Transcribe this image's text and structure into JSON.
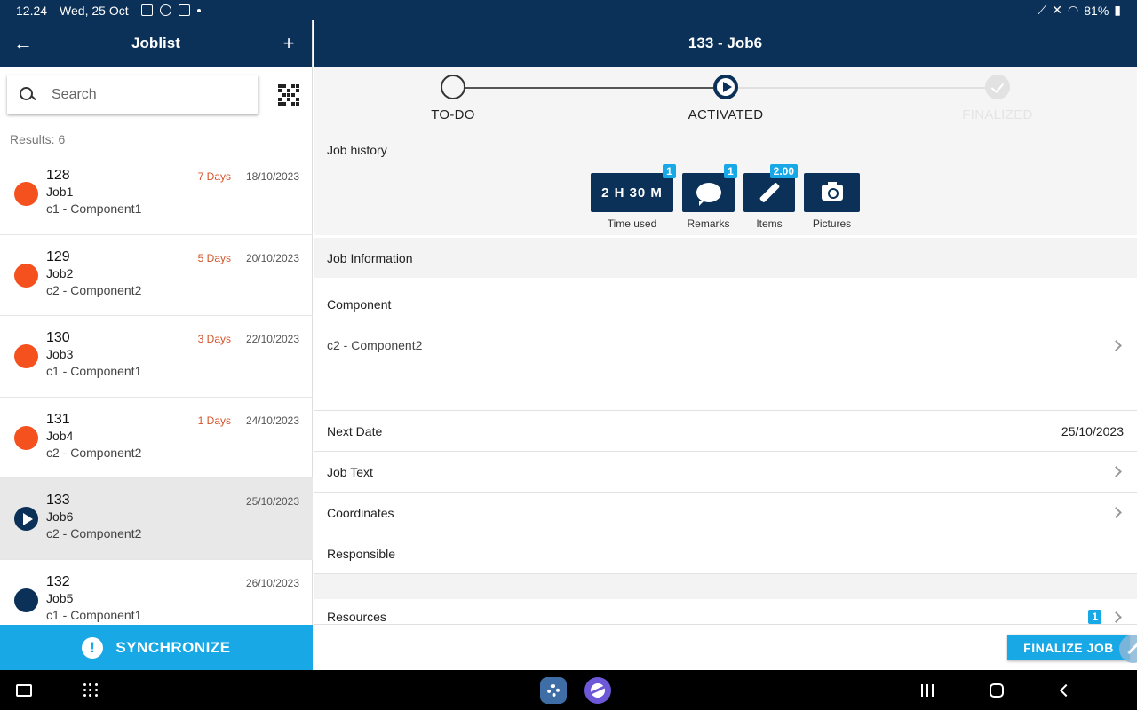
{
  "status_bar": {
    "time": "12.24",
    "date": "Wed, 25 Oct",
    "battery": "81%"
  },
  "joblist": {
    "title": "Joblist",
    "search_placeholder": "Search",
    "results": "Results: 6",
    "jobs": [
      {
        "number": "128",
        "name": "Job1",
        "component": "c1 - Component1",
        "days": "7 Days",
        "date": "18/10/2023",
        "state": "overdue"
      },
      {
        "number": "129",
        "name": "Job2",
        "component": "c2 - Component2",
        "days": "5 Days",
        "date": "20/10/2023",
        "state": "overdue"
      },
      {
        "number": "130",
        "name": "Job3",
        "component": "c1 - Component1",
        "days": "3 Days",
        "date": "22/10/2023",
        "state": "overdue"
      },
      {
        "number": "131",
        "name": "Job4",
        "component": "c2 - Component2",
        "days": "1 Days",
        "date": "24/10/2023",
        "state": "overdue"
      },
      {
        "number": "133",
        "name": "Job6",
        "component": "c2 - Component2",
        "days": "",
        "date": "25/10/2023",
        "state": "activated"
      },
      {
        "number": "132",
        "name": "Job5",
        "component": "c1 - Component1",
        "days": "",
        "date": "26/10/2023",
        "state": "pending"
      }
    ],
    "sync_label": "SYNCHRONIZE"
  },
  "job_detail": {
    "title": "133 - Job6",
    "steps": [
      {
        "label": "TO-DO",
        "state": "todo"
      },
      {
        "label": "ACTIVATED",
        "state": "active"
      },
      {
        "label": "FINALIZED",
        "state": "disabled"
      }
    ],
    "history_label": "Job history",
    "history_buttons": [
      {
        "value": "2 H 30 M",
        "caption": "Time used",
        "badge": "1",
        "icon": "clock-text"
      },
      {
        "value": "",
        "caption": "Remarks",
        "badge": "1",
        "icon": "speech-bubble-icon"
      },
      {
        "value": "",
        "caption": "Items",
        "badge": "2.00",
        "icon": "brush-icon"
      },
      {
        "value": "",
        "caption": "Pictures",
        "badge": "",
        "icon": "camera-icon"
      }
    ],
    "info_header": "Job Information",
    "component_label": "Component",
    "component_value": "c2 - Component2",
    "next_date_label": "Next Date",
    "next_date_value": "25/10/2023",
    "job_text_label": "Job Text",
    "coordinates_label": "Coordinates",
    "responsible_label": "Responsible",
    "resources_label": "Resources",
    "resources_badge": "1",
    "finalize_label": "FINALIZE JOB"
  },
  "colors": {
    "navy": "#0b3158",
    "accent": "#18a8e6",
    "overdue": "#f4511e"
  }
}
